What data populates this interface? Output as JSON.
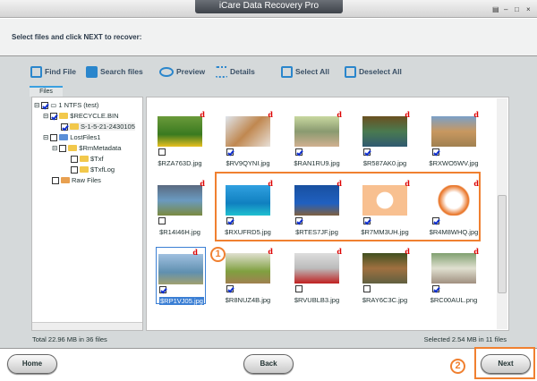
{
  "window": {
    "title": "iCare Data Recovery Pro",
    "controls": [
      "▤",
      "–",
      "□",
      "×"
    ]
  },
  "instruction": "Select files and click NEXT to recover:",
  "toolbar": [
    {
      "label": "Find File",
      "icon": "find-file-icon"
    },
    {
      "label": "Search files",
      "icon": "search-files-icon"
    },
    {
      "label": "Preview",
      "icon": "eye-icon"
    },
    {
      "label": "Details",
      "icon": "details-list-icon"
    },
    {
      "label": "Select All",
      "icon": "select-all-icon"
    },
    {
      "label": "Deselect All",
      "icon": "deselect-all-icon"
    }
  ],
  "tabs": {
    "files": "Files"
  },
  "tree": [
    {
      "label": "1 NTFS (test)",
      "checked": true
    },
    {
      "label": "$RECYCLE.BIN",
      "checked": true
    },
    {
      "label": "S-1-5-21-2430105",
      "checked": true
    },
    {
      "label": "LostFiles1",
      "checked": false
    },
    {
      "label": "$RmMetadata",
      "checked": false
    },
    {
      "label": "$Txf",
      "checked": false
    },
    {
      "label": "$TxfLog",
      "checked": false
    },
    {
      "label": "Raw Files",
      "checked": false
    }
  ],
  "files": [
    {
      "name": "$RZA763D.jpg",
      "checked": false,
      "badge": "d"
    },
    {
      "name": "$RV9QYNI.jpg",
      "checked": true,
      "badge": "d"
    },
    {
      "name": "$RAN1RU9.jpg",
      "checked": true,
      "badge": "d"
    },
    {
      "name": "$R587AK0.jpg",
      "checked": true,
      "badge": "d"
    },
    {
      "name": "$RXWO5WV.jpg",
      "checked": true,
      "badge": "d"
    },
    {
      "name": "$R14I46H.jpg",
      "checked": false,
      "badge": "d"
    },
    {
      "name": "$RXUFRD5.jpg",
      "checked": true,
      "badge": "d"
    },
    {
      "name": "$RTES7JF.jpg",
      "checked": true,
      "badge": "d"
    },
    {
      "name": "$R7MM3UH.jpg",
      "checked": true,
      "badge": "d"
    },
    {
      "name": "$R4M8WHQ.jpg",
      "checked": true,
      "badge": "d"
    },
    {
      "name": "$RP1VJ05.jpg",
      "checked": true,
      "badge": "d",
      "selected": true
    },
    {
      "name": "$R8NUZ4B.jpg",
      "checked": true,
      "badge": "d"
    },
    {
      "name": "$RVUBLB3.jpg",
      "checked": false,
      "badge": "d"
    },
    {
      "name": "$RAY6C3C.jpg",
      "checked": false,
      "badge": "d"
    },
    {
      "name": "$RC00AUL.png",
      "checked": true,
      "badge": "d"
    }
  ],
  "status": {
    "total": "Total 22.96 MB in 36 files",
    "selected": "Selected 2.54 MB in 11 files"
  },
  "buttons": {
    "home": "Home",
    "back": "Back",
    "next": "Next"
  },
  "annotations": {
    "step1": "1",
    "step2": "2",
    "accent": "#f08030"
  }
}
